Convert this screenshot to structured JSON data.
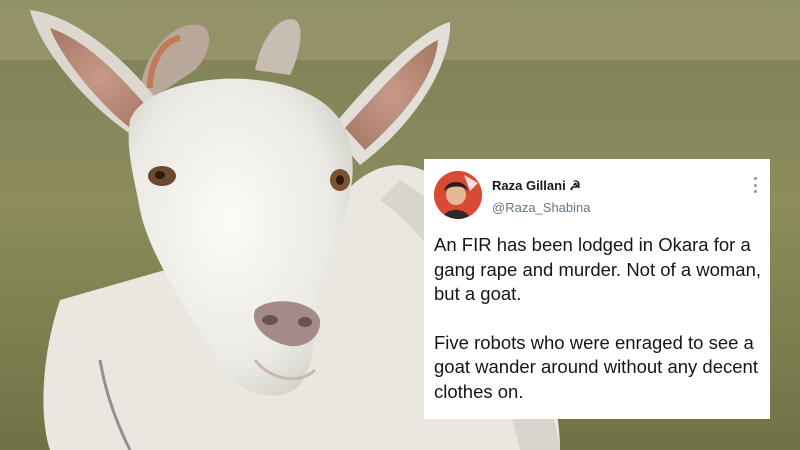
{
  "tweet": {
    "display_name": "Raza Gillani ☭",
    "username": "@Raza_Shabina",
    "paragraph_1": "An FIR has been lodged in Okara for a gang rape and murder. Not of a woman, but a goat.",
    "paragraph_2": "Five robots who were enraged to see a goat wander around without any decent clothes on."
  },
  "icons": {
    "menu": "more-options-icon",
    "avatar": "avatar"
  },
  "colors": {
    "card_background": "#ffffff",
    "text_primary": "#14171a",
    "text_secondary": "#657786",
    "avatar_red": "#d63a2a"
  }
}
